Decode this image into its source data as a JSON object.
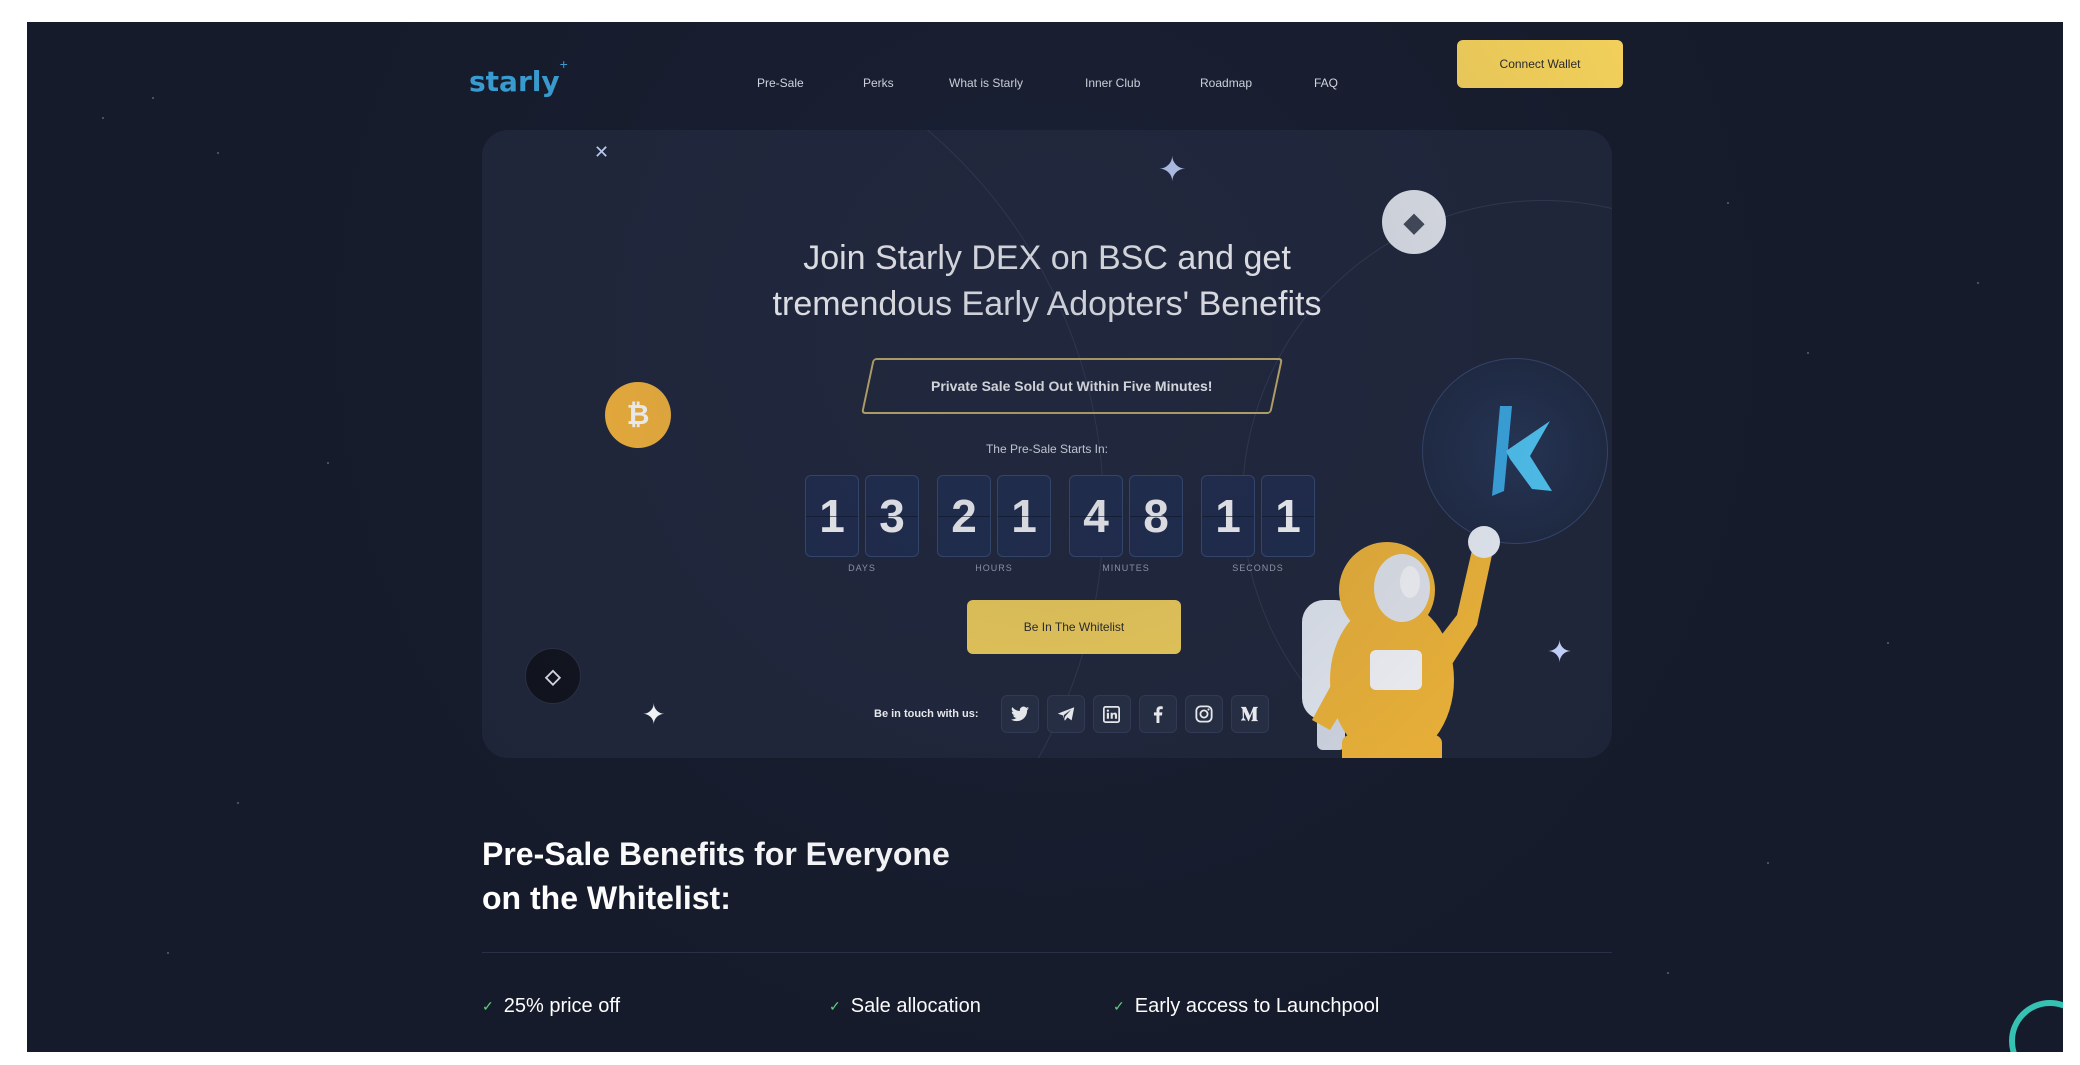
{
  "nav": {
    "logo": "starly",
    "links": [
      "Pre-Sale",
      "Perks",
      "What is Starly",
      "Inner Club",
      "Roadmap",
      "FAQ"
    ],
    "connect_label": "Connect Wallet"
  },
  "hero": {
    "title_line1": "Join Starly DEX on BSC and get",
    "title_line2": "tremendous Early Adopters' Benefits",
    "badge": "Private Sale Sold Out Within Five Minutes!",
    "starts_label": "The Pre-Sale Starts In:",
    "countdown": [
      {
        "digits": [
          "1",
          "3"
        ],
        "label": "DAYS"
      },
      {
        "digits": [
          "2",
          "1"
        ],
        "label": "HOURS"
      },
      {
        "digits": [
          "4",
          "8"
        ],
        "label": "MINUTES"
      },
      {
        "digits": [
          "1",
          "1"
        ],
        "label": "SECONDS"
      }
    ],
    "whitelist_label": "Be In The Whitelist",
    "touch_label": "Be in touch with us:",
    "social": [
      {
        "icon": "twitter-icon",
        "glyph": "🐦"
      },
      {
        "icon": "telegram-icon",
        "glyph": "➤"
      },
      {
        "icon": "linkedin-icon",
        "glyph": "in"
      },
      {
        "icon": "facebook-icon",
        "glyph": "f"
      },
      {
        "icon": "instagram-icon",
        "glyph": "◎"
      },
      {
        "icon": "medium-icon",
        "glyph": "M"
      }
    ]
  },
  "benefits": {
    "title_line1": "Pre-Sale Benefits for Everyone",
    "title_line2": "on the Whitelist:",
    "items": [
      "25% price off",
      "Sale allocation",
      "Early access to Launchpool"
    ]
  },
  "colors": {
    "background": "#161b2b",
    "card": "#1f2538",
    "accent_yellow": "#f9d55a",
    "brand_blue": "#3aa1d6"
  }
}
